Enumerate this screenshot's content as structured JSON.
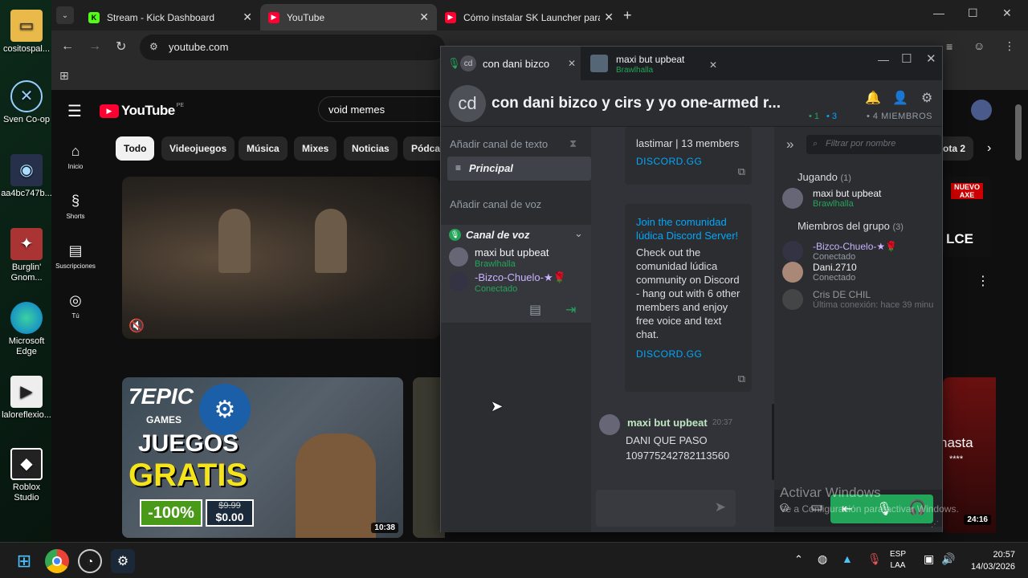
{
  "desktop": {
    "icons": [
      "cositospal...",
      "Sven Co-op",
      "aa4bc747b...",
      "Burglin' Gnom...",
      "Microsoft Edge",
      "laloreflexio...",
      "Roblox Studio"
    ]
  },
  "browser": {
    "tabs": [
      {
        "label": "Stream - Kick Dashboard",
        "icon": "kick-icon"
      },
      {
        "label": "YouTube",
        "icon": "youtube-icon"
      },
      {
        "label": "Cómo instalar SK Launcher para",
        "icon": "youtube-icon"
      }
    ],
    "url": "youtube.com"
  },
  "youtube": {
    "logo": "YouTube",
    "region": "PE",
    "search_value": "void memes",
    "nav": [
      "Inicio",
      "Shorts",
      "Suscripciones",
      "Tú"
    ],
    "chips": [
      "Todo",
      "Videojuegos",
      "Música",
      "Mixes",
      "Noticias",
      "Pódcas",
      "ota 2"
    ],
    "thumb1": {
      "line1": "7EPIC",
      "line2": "GAMES",
      "line3": "JUEGOS",
      "line4": "GRATIS",
      "badge": "-100%",
      "old_price": "$9.99",
      "new_price": "$0.00",
      "duration": "10:38"
    },
    "thumb3": {
      "text": "hasta",
      "stars": "****",
      "duration": "24:16"
    },
    "ad_label": "NUEVO AXE",
    "ad_text": "LCE"
  },
  "discord": {
    "tabs": [
      {
        "label": "con dani bizco",
        "avatar": "cd"
      },
      {
        "label": "maxi but upbeat",
        "sub": "Brawlhalla"
      }
    ],
    "header": {
      "avatar": "cd",
      "title": "con dani bizco y cirs y yo one-armed r...",
      "online": "1",
      "voice": "3",
      "members": "4 MIEMBROS"
    },
    "sidebar": {
      "add_text": "Añadir canal de texto",
      "principal": "Principal",
      "add_voice": "Añadir canal de voz",
      "voice_channel": "Canal de voz",
      "voice_users": [
        {
          "name": "maxi but upbeat",
          "status": "Brawlhalla"
        },
        {
          "name": "-Bizco-Chuelo-★🌹",
          "status": "Conectado"
        }
      ]
    },
    "chat": {
      "embed1": {
        "text": "lastimar | 13 members",
        "link": "DISCORD.GG"
      },
      "embed2": {
        "title": "Join the comunidad lúdica Discord Server!",
        "text": "Check out the comunidad lúdica community on Discord - hang out with 6 other members and enjoy free voice and text chat.",
        "link": "DISCORD.GG"
      },
      "message": {
        "author": "maxi but upbeat",
        "time": "20:37",
        "line1": "DANI QUE PASO",
        "line2": "1097752427821135​60"
      }
    },
    "members": {
      "filter_placeholder": "Filtrar por nombre",
      "playing_header": "Jugando",
      "playing_count": "(1)",
      "playing": [
        {
          "name": "maxi but upbeat",
          "status": "Brawlhalla"
        }
      ],
      "group_header": "Miembros del grupo",
      "group_count": "(3)",
      "group": [
        {
          "name": "-Bizco-Chuelo-★🌹",
          "status": "Conectado"
        },
        {
          "name": "Dani.2710",
          "status": "Conectado"
        },
        {
          "name": "Cris DE CHIL",
          "status": "Última conexión: hace 39 minu"
        }
      ]
    }
  },
  "watermark": {
    "line1": "Activar Windows",
    "line2": "Ve a Configuración para activar Windows."
  },
  "taskbar": {
    "lang1": "ESP",
    "lang2": "LAA",
    "time": "20:57",
    "date": "14/03/2026"
  },
  "colors": {
    "discord_green": "#23a559",
    "youtube_red": "#ff0033",
    "link_blue": "#00a8fc"
  }
}
